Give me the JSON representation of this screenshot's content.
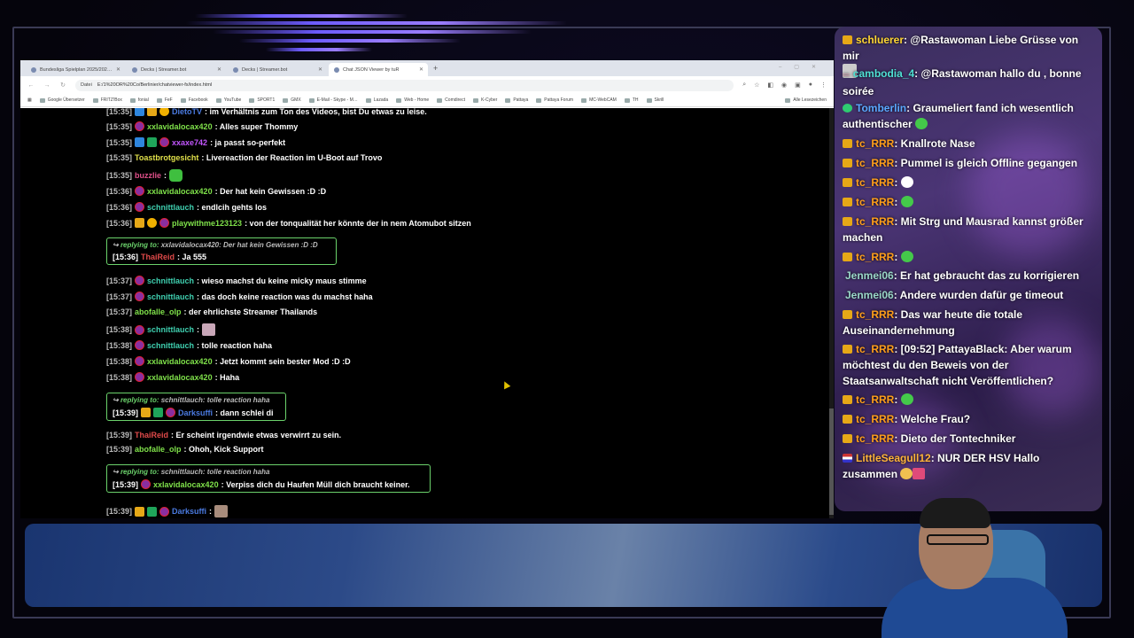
{
  "browser": {
    "tabs": [
      {
        "label": "Bundesliga Spielplan 2025/202…",
        "active": false
      },
      {
        "label": "Decks | Streamer.bot",
        "active": false
      },
      {
        "label": "Decks | Streamer.bot",
        "active": false
      },
      {
        "label": "Chat JSON Viewer by tuR",
        "active": true
      }
    ],
    "new_tab": "+",
    "url_label": "Datei",
    "url": "E:/1%20OR%20Co/Berlinier/chatviewer-fx/index.html",
    "bookmarks": [
      "Google Übersetzer",
      "FRITZ!Box",
      "fonial",
      "FeF",
      "Facebook",
      "YouTube",
      "SPORT1",
      "GMX",
      "E-Mail - Skype - M…",
      "Lazada",
      "Web - Home",
      "Comdirect",
      "K-Cyber",
      "Pattaya",
      "Pattaya Forum",
      "MC-WebCAM",
      "TH",
      "Skrill"
    ],
    "bookmarks_more": "Alle Lesezeichen"
  },
  "chat": {
    "top_partial": {
      "time": "[15:35]",
      "user": "DietoTV",
      "text": ": im Verhältnis zum Ton des Videos, bist Du etwas zu leise."
    },
    "messages": [
      {
        "time": "[15:35]",
        "user": "xxlavidalocax420",
        "text": ": Alles super Thommy"
      },
      {
        "time": "[15:35]",
        "user": "xxaxe742",
        "text": ": ja passt so-perfekt"
      },
      {
        "time": "[15:35]",
        "user": "Toastbrotgesicht",
        "text": ": Livereaction der Reaction im U-Boot auf Trovo"
      },
      {
        "time": "[15:35]",
        "user": "buzzlie",
        "text": ":"
      },
      {
        "time": "[15:36]",
        "user": "xxlavidalocax420",
        "text": ": Der hat kein Gewissen :D :D"
      },
      {
        "time": "[15:36]",
        "user": "schnittlauch",
        "text": ": endlcih gehts los"
      },
      {
        "time": "[15:36]",
        "user": "playwithme123123",
        "text": ": von der tonqualität her könnte der in nem Atomubot sitzen"
      },
      {
        "time": "[15:37]",
        "user": "schnittlauch",
        "text": ": wieso machst du keine micky maus stimme"
      },
      {
        "time": "[15:37]",
        "user": "schnittlauch",
        "text": ": das doch keine reaction was du machst haha"
      },
      {
        "time": "[15:37]",
        "user": "abofalle_olp",
        "text": ": der ehrlichste Streamer Thailands"
      },
      {
        "time": "[15:38]",
        "user": "schnittlauch",
        "text": ":"
      },
      {
        "time": "[15:38]",
        "user": "schnittlauch",
        "text": ": tolle reaction haha"
      },
      {
        "time": "[15:38]",
        "user": "xxlavidalocax420",
        "text": ": Jetzt kommt sein bester Mod :D :D"
      },
      {
        "time": "[15:38]",
        "user": "xxlavidalocax420",
        "text": ": Haha"
      },
      {
        "time": "[15:39]",
        "user": "ThaiReid",
        "text": ": Er scheint irgendwie etwas verwirrt zu sein."
      },
      {
        "time": "[15:39]",
        "user": "abofalle_olp",
        "text": ": Ohoh, Kick Support"
      },
      {
        "time": "[15:39]",
        "user": "Darksuffi",
        "text": ":"
      }
    ],
    "replies": [
      {
        "lead": "replying to:",
        "ref": "xxlavidalocax420: Der hat kein Gewissen :D :D",
        "time": "[15:36]",
        "user": "ThaiReid",
        "text": ": Ja 555"
      },
      {
        "lead": "replying to:",
        "ref": "schnittlauch: tolle reaction haha",
        "time": "[15:39]",
        "user": "Darksuffi",
        "text": ": dann schlei di"
      },
      {
        "lead": "replying to:",
        "ref": "schnittlauch: tolle reaction haha",
        "time": "[15:39]",
        "user": "xxlavidalocax420",
        "text": ": Verpiss dich du Haufen Müll dich braucht keiner."
      }
    ]
  },
  "overlay": {
    "messages": [
      {
        "user": "schluerer",
        "text": ": @Rastawoman Liebe Grüsse von mir"
      },
      {
        "user": "cambodia_4",
        "text": ": @Rastawoman hallo du , bonne soirée"
      },
      {
        "user": "Tomberlin",
        "text": ": Graumeliert fand ich wesentlich authentischer"
      },
      {
        "user": "tc_RRR",
        "text": ": Knallrote Nase"
      },
      {
        "user": "tc_RRR",
        "text": ": Pummel is gleich Offline gegangen"
      },
      {
        "user": "tc_RRR",
        "text": ":"
      },
      {
        "user": "tc_RRR",
        "text": ":"
      },
      {
        "user": "tc_RRR",
        "text": ": Mit Strg und Mausrad kannst größer machen"
      },
      {
        "user": "tc_RRR",
        "text": ":"
      },
      {
        "user": "Jenmei06",
        "text": ": Er hat gebraucht das zu korrigieren"
      },
      {
        "user": "Jenmei06",
        "text": ": Andere wurden dafür ge timeout"
      },
      {
        "user": "tc_RRR",
        "text": ": Das war heute die totale Auseinandernehmung"
      },
      {
        "user": "tc_RRR",
        "text": ": [09:52] PattayaBlack: Aber warum möchtest du den Beweis von der Staatsanwaltschaft nicht Veröffentlichen?"
      },
      {
        "user": "tc_RRR",
        "text": ":"
      },
      {
        "user": "tc_RRR",
        "text": ": Welche Frau?"
      },
      {
        "user": "tc_RRR",
        "text": ": Dieto der Tontechniker"
      },
      {
        "user": "LittleSeagull12",
        "text": ": NUR DER HSV Hallo zusammen"
      }
    ]
  },
  "colors": {
    "accent_reply_border": "#6bd26b",
    "overlay_bg": "#3a2e5c",
    "bottom_bar": "#2c4a88"
  }
}
